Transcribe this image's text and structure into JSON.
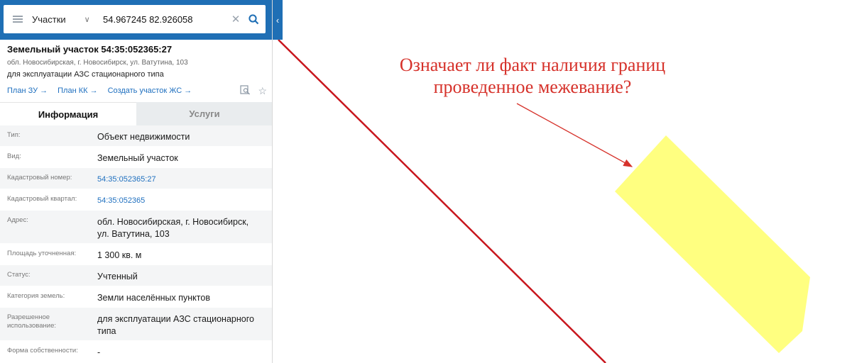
{
  "search": {
    "layer": "Участки",
    "query": "54.967245 82.926058"
  },
  "object": {
    "title": "Земельный участок 54:35:052365:27",
    "address": "обл. Новосибирская, г. Новосибирск, ул. Ватутина, 103",
    "purpose": "для эксплуатации АЗС стационарного типа",
    "links": [
      "План ЗУ →",
      "План КК →",
      "Создать участок ЖС →"
    ]
  },
  "tabs": [
    "Информация",
    "Услуги"
  ],
  "info": [
    {
      "key": "Тип:",
      "value": "Объект недвижимости"
    },
    {
      "key": "Вид:",
      "value": "Земельный участок"
    },
    {
      "key": "Кадастровый номер:",
      "value": "54:35:052365:27"
    },
    {
      "key": "Кадастровый квартал:",
      "value": "54:35:052365"
    },
    {
      "key": "Адрес:",
      "value": "обл. Новосибирская, г. Новосибирск, ул. Ватутина, 103"
    },
    {
      "key": "Площадь уточненная:",
      "value": "1 300 кв. м"
    },
    {
      "key": "Статус:",
      "value": "Учтенный"
    },
    {
      "key": "Категория земель:",
      "value": "Земли населённых пунктов"
    },
    {
      "key": "Разрешенное использование:",
      "value": "для эксплуатации АЗС стационарного типа"
    },
    {
      "key": "Форма собственности:",
      "value": "-"
    }
  ],
  "annotation": {
    "line1": "Означает ли факт наличия границ",
    "line2": "проведенное межевание?"
  },
  "colors": {
    "header": "#1f6fb5",
    "link": "#1e6fbf",
    "parcel_fill": "#ffff80",
    "boundary": "#c8161d",
    "annotation": "#d6322b"
  },
  "icons": [
    "menu-icon",
    "chevron-down-icon",
    "clear-icon",
    "search-icon",
    "collapse-icon",
    "preview-icon",
    "star-icon",
    "arrow-icon"
  ]
}
